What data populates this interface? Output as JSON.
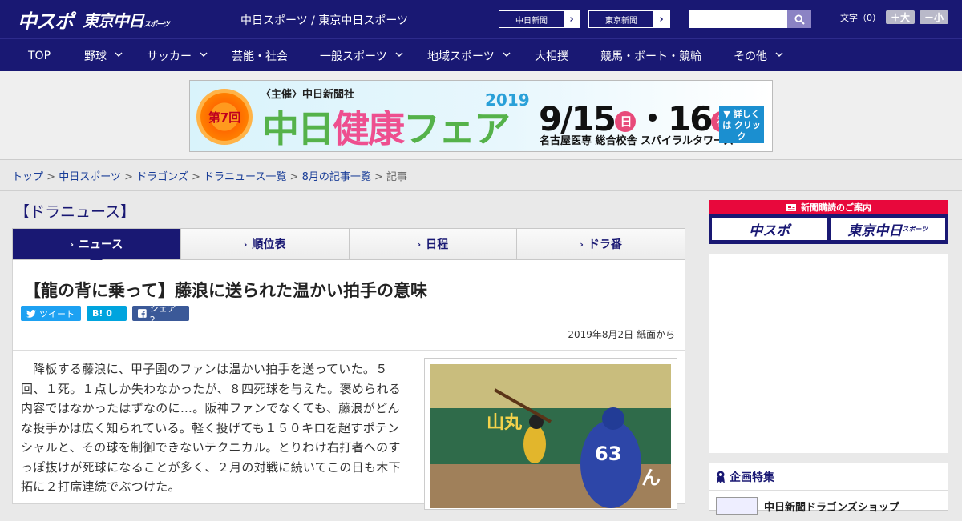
{
  "header": {
    "logo_chuspo": "中スポ",
    "logo_tokyo": "東京中日",
    "logo_tokyo_small": "スポーツ",
    "site_title": "中日スポーツ / 東京中日スポーツ",
    "link_chunichi": "中日新聞",
    "link_tokyo": "東京新聞",
    "arrow": "›",
    "search_placeholder": "",
    "font_label": "文字（0）",
    "font_larger": "＋大",
    "font_smaller": "－小"
  },
  "nav": {
    "items": [
      {
        "label": "TOP",
        "has_menu": false
      },
      {
        "label": "野球",
        "has_menu": true
      },
      {
        "label": "サッカー",
        "has_menu": true
      },
      {
        "label": "芸能・社会",
        "has_menu": false
      },
      {
        "label": "一般スポーツ",
        "has_menu": true
      },
      {
        "label": "地域スポーツ",
        "has_menu": true
      },
      {
        "label": "大相撲",
        "has_menu": false
      },
      {
        "label": "競馬・ボート・競輪",
        "has_menu": false
      },
      {
        "label": "その他",
        "has_menu": true
      }
    ],
    "chevron": "⌄"
  },
  "banner": {
    "host": "〈主催〉中日新聞社",
    "badge": "第7回",
    "title_a": "中日",
    "title_b": "健康",
    "title_c": "フェア",
    "year": "2019",
    "date_a": "9/15",
    "day_a": "日",
    "date_sep": "・16",
    "day_b": "祝",
    "venue": "名古屋医専 総合校舎 スパイラルタワーズ",
    "more": "▼ 詳しくは クリック"
  },
  "breadcrumb": {
    "items": [
      "トップ",
      "中日スポーツ",
      "ドラゴンズ",
      "ドラニュース一覧",
      "8月の記事一覧"
    ],
    "current": "記事",
    "separator": " > "
  },
  "section_title": "【ドラニュース】",
  "tabs": [
    {
      "label": "ニュース",
      "active": true
    },
    {
      "label": "順位表",
      "active": false
    },
    {
      "label": "日程",
      "active": false
    },
    {
      "label": "ドラ番",
      "active": false
    }
  ],
  "tab_arrow": "›",
  "article": {
    "headline": "【龍の背に乗って】藤浪に送られた温かい拍手の意味",
    "tweet_label": "ツイート",
    "hatena_label": "B! 0",
    "share_label": "シェア 2",
    "date": "2019年8月2日 紙面から",
    "body": "降板する藤浪に、甲子園のファンは温かい拍手を送っていた。５回、１死。１点しか失わなかったが、８四死球を与えた。褒められる内容ではなかったはずなのに…。阪神ファンでなくても、藤浪がどんな投手かは広く知られている。軽く投げても１５０キロを超すポテンシャルと、その球を制御できないテクニカル。とりわけ右打者へのすっぽ抜けが死球になることが多く、２月の対戦に続いてこの日も木下拓に２打席連続でぶつけた。",
    "photo_jersey_number": "63",
    "photo_sign_left": "山丸",
    "photo_sign_right": "ほけん"
  },
  "sidebar": {
    "subscribe_header": "新聞購読のご案内",
    "subscribe_a": "中スポ",
    "subscribe_b": "東京中日",
    "subscribe_b_small": "スポーツ",
    "kikaku_title": "企画特集",
    "kikaku_item": "中日新聞ドラゴンズショップ"
  },
  "colors": {
    "brand_navy": "#191873",
    "link_blue": "#1a3e98",
    "twitter": "#1da1f2",
    "hatena": "#00a4de",
    "facebook": "#3b5998",
    "subscribe_red": "#e8083c"
  }
}
